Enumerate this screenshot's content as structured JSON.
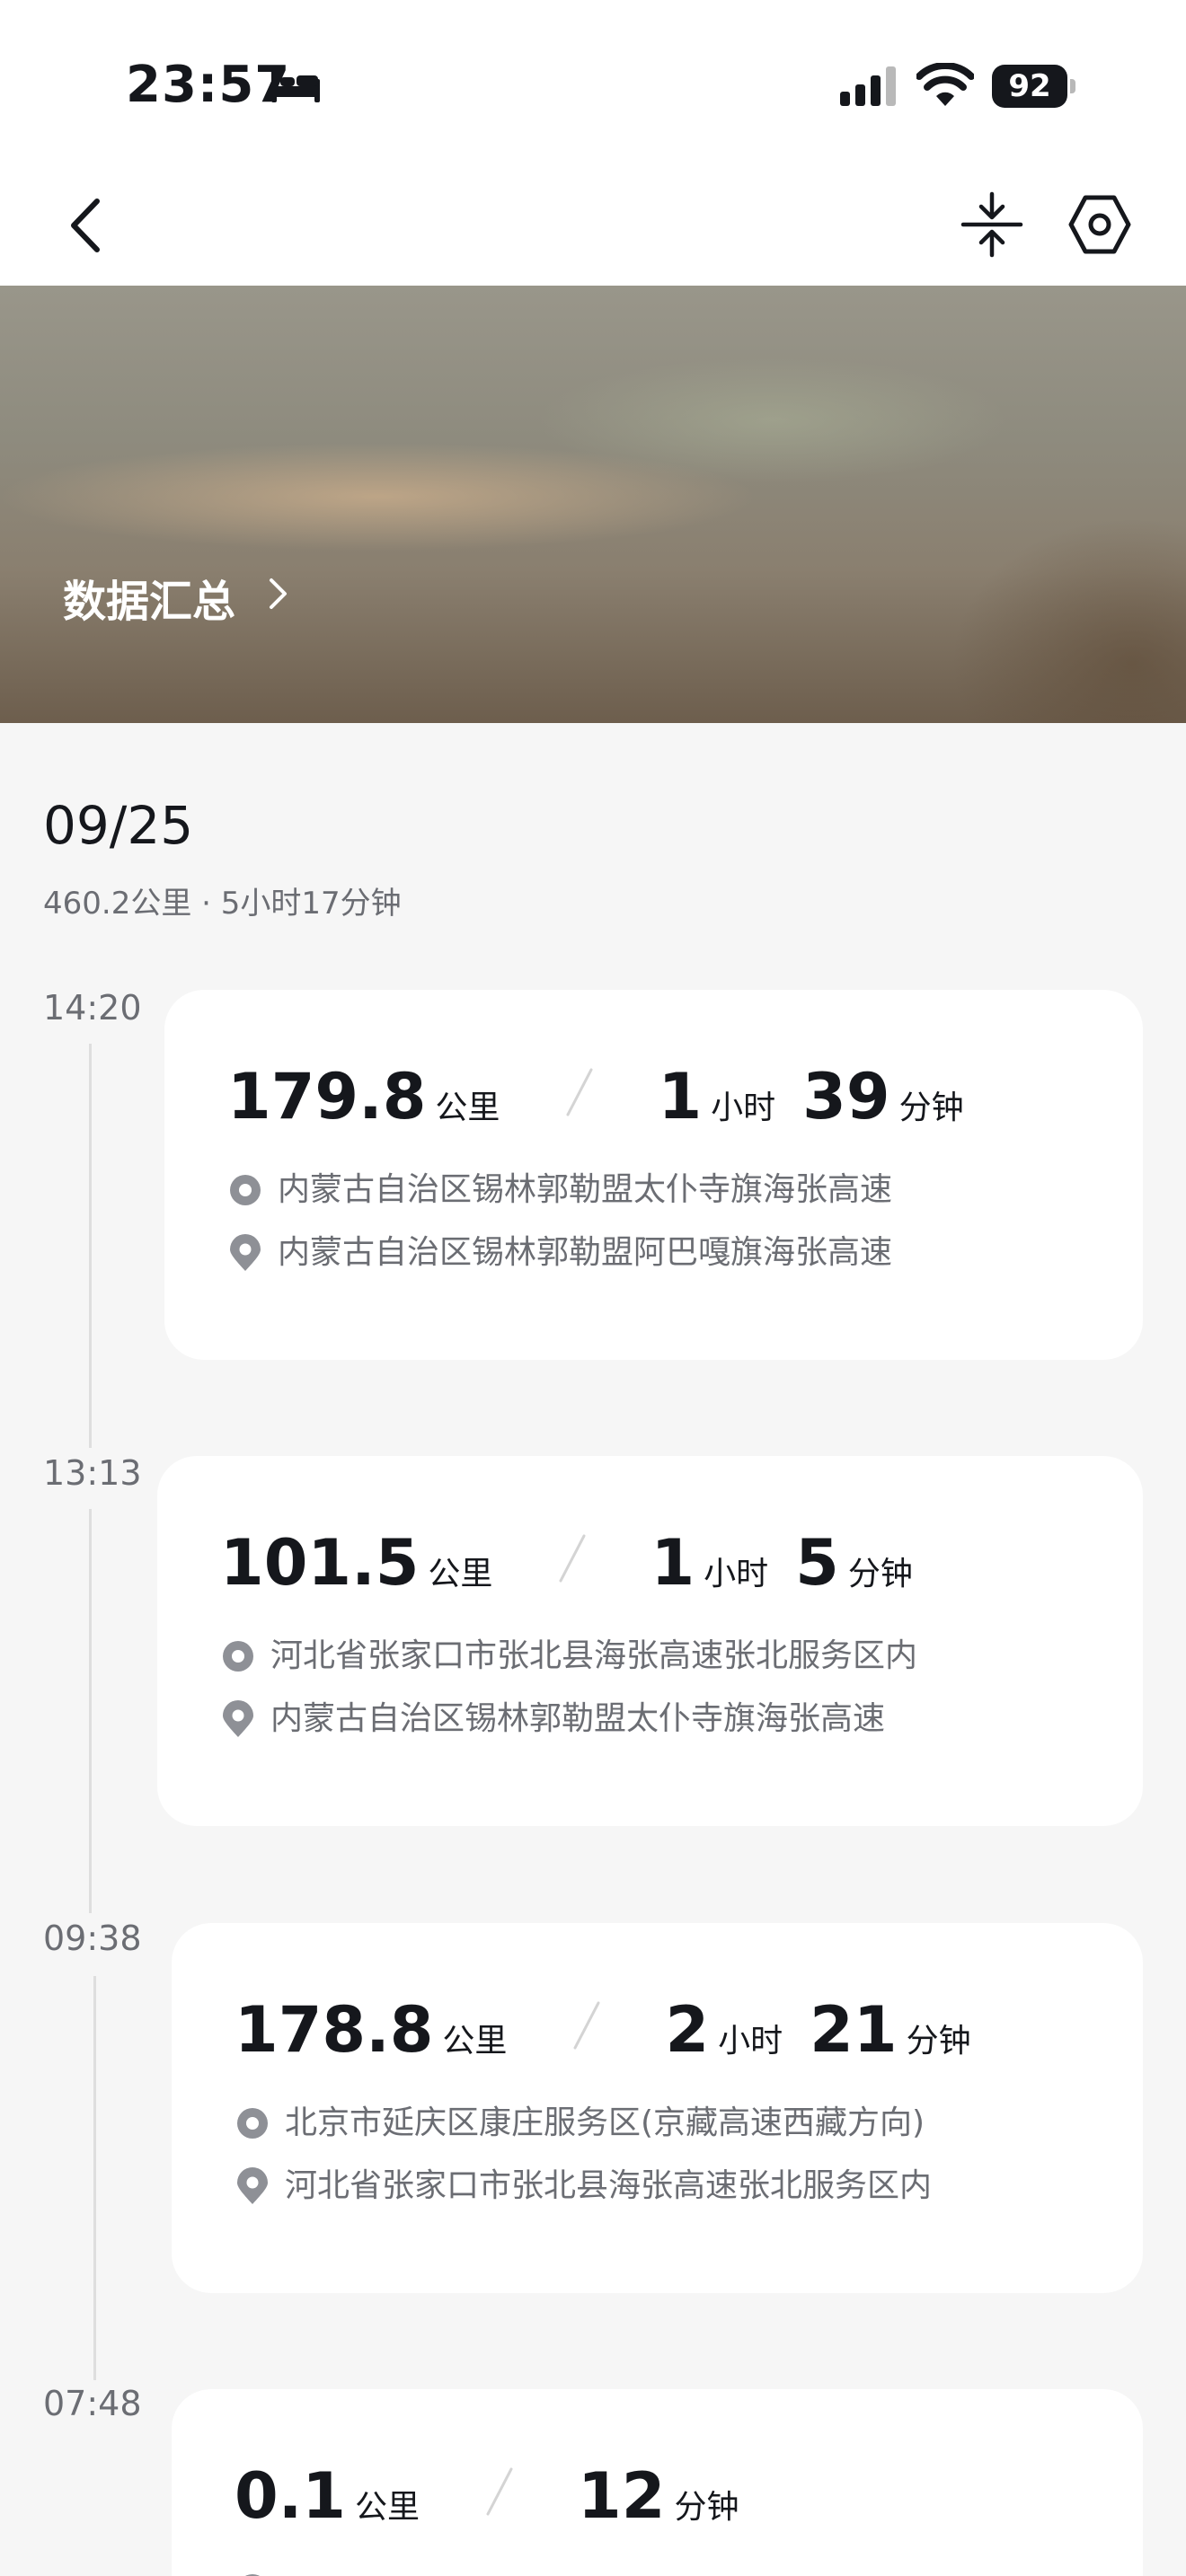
{
  "status_bar": {
    "time": "23:57",
    "battery": "92"
  },
  "banner": {
    "title": "数据汇总"
  },
  "day": {
    "date": "09/25",
    "summary": "460.2公里 · 5小时17分钟"
  },
  "trips": [
    {
      "time": "14:20",
      "distance": "179.8",
      "distance_unit": "公里",
      "hours": "1",
      "hours_unit": "小时",
      "minutes": "39",
      "minutes_unit": "分钟",
      "start": "内蒙古自治区锡林郭勒盟太仆寺旗海张高速",
      "end": "内蒙古自治区锡林郭勒盟阿巴嘎旗海张高速"
    },
    {
      "time": "13:13",
      "distance": "101.5",
      "distance_unit": "公里",
      "hours": "1",
      "hours_unit": "小时",
      "minutes": "5",
      "minutes_unit": "分钟",
      "start": "河北省张家口市张北县海张高速张北服务区内",
      "end": "内蒙古自治区锡林郭勒盟太仆寺旗海张高速"
    },
    {
      "time": "09:38",
      "distance": "178.8",
      "distance_unit": "公里",
      "hours": "2",
      "hours_unit": "小时",
      "minutes": "21",
      "minutes_unit": "分钟",
      "start": "北京市延庆区康庄服务区(京藏高速西藏方向)",
      "end": "河北省张家口市张北县海张高速张北服务区内"
    },
    {
      "time": "07:48",
      "distance": "0.1",
      "distance_unit": "公里",
      "minutes": "12",
      "minutes_unit": "分钟"
    }
  ],
  "colors": {
    "text": "#15171c",
    "secondary": "#6b6d73",
    "background": "#f6f6f6",
    "card": "#ffffff"
  },
  "icons": [
    "bed-icon",
    "cellular-signal-icon",
    "wifi-icon",
    "battery-icon",
    "back-arrow-icon",
    "collapse-icon",
    "settings-icon",
    "chevron-right-icon",
    "start-point-icon",
    "end-point-icon"
  ]
}
